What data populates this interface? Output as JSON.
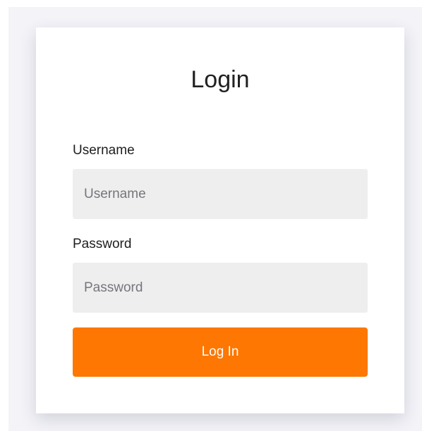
{
  "login": {
    "title": "Login",
    "username_label": "Username",
    "username_placeholder": "Username",
    "password_label": "Password",
    "password_placeholder": "Password",
    "submit_label": "Log In"
  },
  "colors": {
    "accent": "#fd7702",
    "input_background": "#eeeeee",
    "page_background": "#f3f3f8"
  }
}
